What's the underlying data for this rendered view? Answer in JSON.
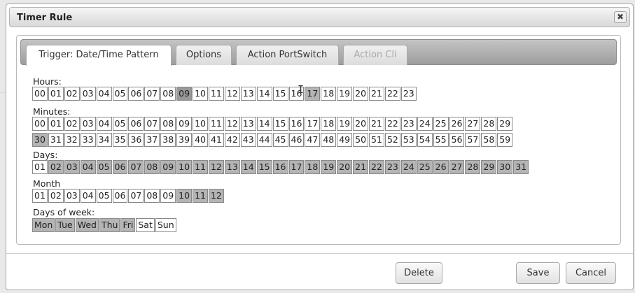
{
  "dialog": {
    "title": "Timer Rule",
    "close_symbol": "✖"
  },
  "tabs": [
    {
      "label": "Trigger: Date/Time Pattern",
      "state": "active"
    },
    {
      "label": "Options",
      "state": "normal"
    },
    {
      "label": "Action PortSwitch",
      "state": "normal"
    },
    {
      "label": "Action Cli",
      "state": "disabled"
    }
  ],
  "hours": {
    "label": "Hours:",
    "values": [
      "00",
      "01",
      "02",
      "03",
      "04",
      "05",
      "06",
      "07",
      "08",
      "09",
      "10",
      "11",
      "12",
      "13",
      "14",
      "15",
      "16",
      "17",
      "18",
      "19",
      "20",
      "21",
      "22",
      "23"
    ],
    "selected": [
      "09",
      "17"
    ]
  },
  "minutes": {
    "label": "Minutes:",
    "row1": [
      "00",
      "01",
      "02",
      "03",
      "04",
      "05",
      "06",
      "07",
      "08",
      "09",
      "10",
      "11",
      "12",
      "13",
      "14",
      "15",
      "16",
      "17",
      "18",
      "19",
      "20",
      "21",
      "22",
      "23",
      "24",
      "25",
      "26",
      "27",
      "28",
      "29"
    ],
    "row2": [
      "30",
      "31",
      "32",
      "33",
      "34",
      "35",
      "36",
      "37",
      "38",
      "39",
      "40",
      "41",
      "42",
      "43",
      "44",
      "45",
      "46",
      "47",
      "48",
      "49",
      "50",
      "51",
      "52",
      "53",
      "54",
      "55",
      "56",
      "57",
      "58",
      "59"
    ],
    "selected": [
      "30"
    ]
  },
  "days": {
    "label": "Days:",
    "values": [
      "01",
      "02",
      "03",
      "04",
      "05",
      "06",
      "07",
      "08",
      "09",
      "10",
      "11",
      "12",
      "13",
      "14",
      "15",
      "16",
      "17",
      "18",
      "19",
      "20",
      "21",
      "22",
      "23",
      "24",
      "25",
      "26",
      "27",
      "28",
      "29",
      "30",
      "31"
    ],
    "selected": [
      "02",
      "03",
      "04",
      "05",
      "06",
      "07",
      "08",
      "09",
      "10",
      "11",
      "12",
      "13",
      "14",
      "15",
      "16",
      "17",
      "18",
      "19",
      "20",
      "21",
      "22",
      "23",
      "24",
      "25",
      "26",
      "27",
      "28",
      "29",
      "30",
      "31"
    ]
  },
  "month": {
    "label": "Month",
    "values": [
      "01",
      "02",
      "03",
      "04",
      "05",
      "06",
      "07",
      "08",
      "09",
      "10",
      "11",
      "12"
    ],
    "selected": [
      "10",
      "11",
      "12"
    ]
  },
  "weekdays": {
    "label": "Days of week:",
    "values": [
      "Mon",
      "Tue",
      "Wed",
      "Thu",
      "Fri",
      "Sat",
      "Sun"
    ],
    "selected": [
      "Mon",
      "Tue",
      "Wed",
      "Thu",
      "Fri"
    ]
  },
  "footer": {
    "delete_label": "Delete",
    "save_label": "Save",
    "cancel_label": "Cancel"
  },
  "colors": {
    "selected_cell": "#b4b4b4",
    "cell_border": "#888888",
    "tabbar": "#a8a8a8"
  }
}
